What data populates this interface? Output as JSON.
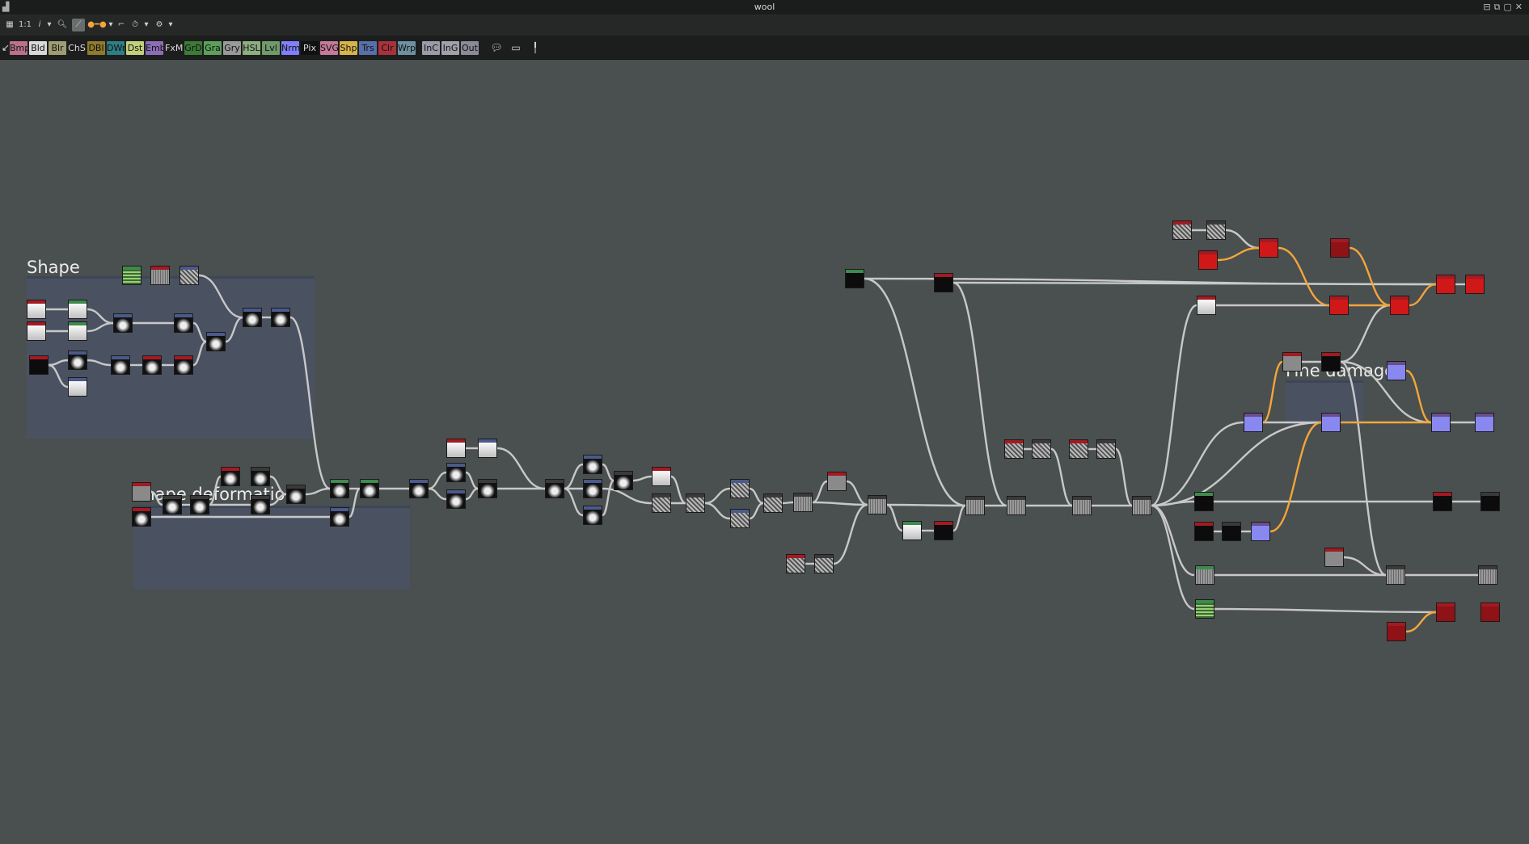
{
  "window": {
    "title": "wool"
  },
  "toolbar": {
    "zoom_label": "1:1",
    "info_label": "i"
  },
  "node_categories": [
    {
      "label": "Bmp",
      "color": "#b9728c"
    },
    {
      "label": "Bld",
      "color": "#d8d8d8"
    },
    {
      "label": "Blr",
      "color": "#9e9c72"
    },
    {
      "label": "ChS",
      "color": "#1d1d1d",
      "text_color": "#dddddd"
    },
    {
      "label": "DBl",
      "color": "#8f7a2c"
    },
    {
      "label": "DWr",
      "color": "#2f7e86"
    },
    {
      "label": "Dst",
      "color": "#c2d07c"
    },
    {
      "label": "Emb",
      "color": "#8c6eb4"
    },
    {
      "label": "FxM",
      "color": "#1d1d1d",
      "text_color": "#dddddd"
    },
    {
      "label": "GrD",
      "color": "#3c7a38"
    },
    {
      "label": "Gra",
      "color": "#5ca05a"
    },
    {
      "label": "Gry",
      "color": "#9a9a9a"
    },
    {
      "label": "HSL",
      "color": "#8fae80"
    },
    {
      "label": "Lvl",
      "color": "#6f9a6a"
    },
    {
      "label": "Nrm",
      "color": "#8080ff"
    },
    {
      "label": "Pix",
      "color": "#111111",
      "text_color": "#dddddd"
    },
    {
      "label": "SVG",
      "color": "#c57a9a"
    },
    {
      "label": "Shp",
      "color": "#d8b34a"
    },
    {
      "label": "Trs",
      "color": "#5870a8"
    },
    {
      "label": "Clr",
      "color": "#a8323c"
    },
    {
      "label": "Wrp",
      "color": "#6f90a0"
    },
    {
      "label": "InC",
      "color": "#9a9aa8"
    },
    {
      "label": "InG",
      "color": "#a0a0aa"
    },
    {
      "label": "Out",
      "color": "#8a8a98"
    }
  ],
  "frames": [
    {
      "title": "Shape"
    },
    {
      "title": "Shape deformation"
    },
    {
      "title": "Fine damage"
    }
  ],
  "colors": {
    "canvas_bg": "#4a4f4f",
    "link_default": "#c8c8c8",
    "link_highlight": "#f2a63a",
    "frame_fill": "#4b5673",
    "node_red": "#d01818",
    "node_normal": "#8888f0"
  },
  "icons": {
    "window_menu": "grid-icon",
    "zoom": "magnifier-icon",
    "timer": "stopwatch-icon",
    "settings": "gear-icon",
    "comment": "speech-bubble-icon",
    "frame": "frame-icon",
    "pin": "pin-icon"
  }
}
